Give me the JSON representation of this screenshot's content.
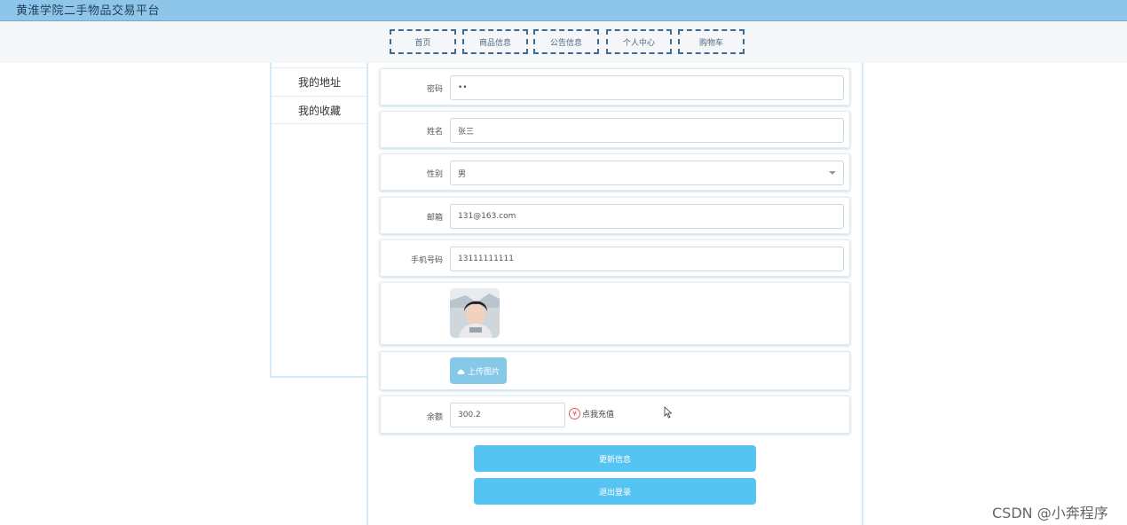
{
  "header": {
    "site_title": "黄淮学院二手物品交易平台"
  },
  "nav": {
    "items": [
      {
        "label": "首页"
      },
      {
        "label": "商品信息"
      },
      {
        "label": "公告信息"
      },
      {
        "label": "个人中心"
      },
      {
        "label": "购物车"
      }
    ]
  },
  "sidebar": {
    "items": [
      {
        "label": "我的地址"
      },
      {
        "label": "我的收藏"
      }
    ]
  },
  "form": {
    "password": {
      "label": "密码",
      "value": "••"
    },
    "name": {
      "label": "姓名",
      "value": "张三"
    },
    "gender": {
      "label": "性别",
      "value": "男"
    },
    "email": {
      "label": "邮箱",
      "value": "131@163.com"
    },
    "phone": {
      "label": "手机号码",
      "value": "13111111111"
    },
    "upload_label": "上传图片",
    "balance": {
      "label": "余额",
      "value": "300.2"
    },
    "recharge_label": "点我充值",
    "recharge_symbol": "¥"
  },
  "actions": {
    "update_label": "更新信息",
    "logout_label": "退出登录"
  },
  "watermark": "CSDN @小奔程序",
  "icons": {
    "upload": "cloud-upload-icon",
    "recharge": "yen-icon",
    "select": "chevron-down-icon"
  },
  "colors": {
    "topbar": "#8dc6e8",
    "accent_button": "#56c4f2",
    "upload_button": "#86c8e8",
    "nav_border": "#3d6a96",
    "recharge_icon": "#e05a5a"
  }
}
